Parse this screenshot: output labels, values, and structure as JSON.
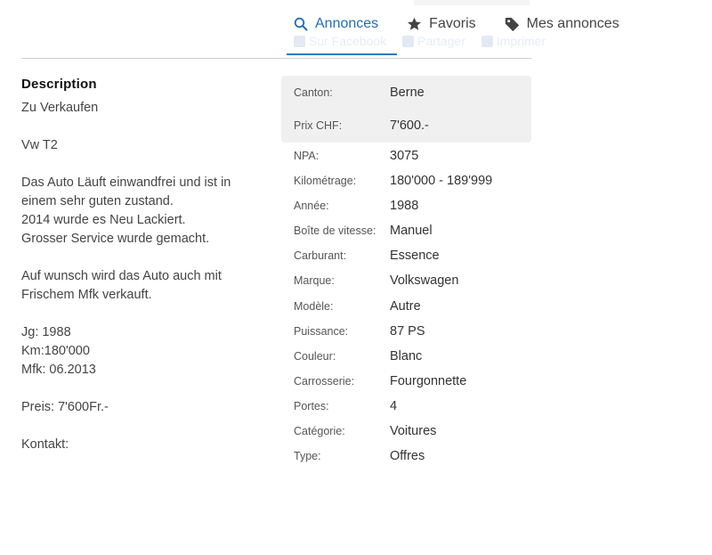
{
  "nav": {
    "items": [
      {
        "label": "Annonces",
        "icon": "search-icon",
        "active": true
      },
      {
        "label": "Favoris",
        "icon": "star-icon",
        "active": false
      },
      {
        "label": "Mes annonces",
        "icon": "tag-icon",
        "active": false
      }
    ],
    "accent_color": "#1f6db5"
  },
  "ghost_share": {
    "facebook_label": "Sur Facebook",
    "share_label": "Partager",
    "print_label": "Imprimer"
  },
  "description": {
    "title": "Description",
    "paragraphs": [
      [
        "Zu Verkaufen"
      ],
      [
        "Vw T2"
      ],
      [
        "Das Auto Läuft einwandfrei und ist in",
        "einem sehr guten zustand.",
        "2014 wurde es Neu Lackiert.",
        "Grosser Service wurde gemacht."
      ],
      [
        "Auf wunsch wird das Auto auch mit",
        "Frischem Mfk verkauft."
      ],
      [
        "Jg: 1988",
        "Km:180'000",
        "Mfk: 06.2013"
      ],
      [
        "Preis: 7'600Fr.-"
      ],
      [
        "Kontakt:"
      ]
    ]
  },
  "details": {
    "highlight": [
      {
        "label": "Canton:",
        "value": "Berne"
      },
      {
        "label": "Prix CHF:",
        "value": "7'600.-"
      }
    ],
    "rows": [
      {
        "label": "NPA:",
        "value": "3075"
      },
      {
        "label": "Kilométrage:",
        "value": "180'000 - 189'999"
      },
      {
        "label": "Année:",
        "value": "1988"
      },
      {
        "label": "Boîte de vitesse:",
        "value": "Manuel"
      },
      {
        "label": "Carburant:",
        "value": "Essence"
      },
      {
        "label": "Marque:",
        "value": "Volkswagen"
      },
      {
        "label": "Modèle:",
        "value": "Autre"
      },
      {
        "label": "Puissance:",
        "value": "87 PS"
      },
      {
        "label": "Couleur:",
        "value": "Blanc"
      },
      {
        "label": "Carrosserie:",
        "value": "Fourgonnette"
      },
      {
        "label": "Portes:",
        "value": "4"
      },
      {
        "label": "Catégorie:",
        "value": "Voitures"
      },
      {
        "label": "Type:",
        "value": "Offres"
      }
    ]
  }
}
